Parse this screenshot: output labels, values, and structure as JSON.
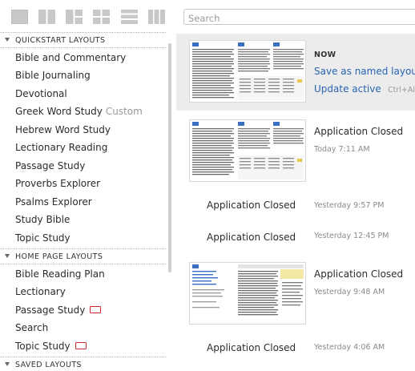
{
  "toolbar": {
    "layout_buttons": [
      "single-pane-layout",
      "two-column-layout",
      "three-pane-layout",
      "four-pane-layout",
      "rows-layout",
      "three-column-layout"
    ],
    "search_placeholder": "Search"
  },
  "sections": [
    {
      "title": "QUICKSTART LAYOUTS",
      "items": [
        {
          "label": "Bible and Commentary"
        },
        {
          "label": "Bible Journaling"
        },
        {
          "label": "Devotional"
        },
        {
          "label": "Greek Word Study",
          "tag": "Custom"
        },
        {
          "label": "Hebrew Word Study"
        },
        {
          "label": "Lectionary Reading"
        },
        {
          "label": "Passage Study"
        },
        {
          "label": "Proverbs Explorer"
        },
        {
          "label": "Psalms Explorer"
        },
        {
          "label": "Study Bible"
        },
        {
          "label": "Topic Study"
        }
      ]
    },
    {
      "title": "HOME PAGE LAYOUTS",
      "items": [
        {
          "label": "Bible Reading Plan"
        },
        {
          "label": "Lectionary"
        },
        {
          "label": "Passage Study",
          "badge": "red"
        },
        {
          "label": "Search"
        },
        {
          "label": "Topic Study",
          "badge": "red"
        }
      ]
    },
    {
      "title": "SAVED LAYOUTS",
      "items": []
    }
  ],
  "history": {
    "current": {
      "label": "NOW",
      "save_link": "Save as named layout",
      "update_link": "Update active",
      "update_shortcut": "Ctrl+Alt"
    },
    "entries": [
      {
        "title": "Application Closed",
        "time": "Today 7:11 AM"
      },
      {
        "title": "Application Closed",
        "time": "Yesterday 9:57 PM"
      },
      {
        "title": "Application Closed",
        "time": "Yesterday 12:45 PM"
      },
      {
        "title": "Application Closed",
        "time": "Yesterday 9:48 AM"
      },
      {
        "title": "Application Closed",
        "time": "Yesterday 4:06 AM"
      }
    ]
  },
  "colors": {
    "link": "#2864b4",
    "badge": "#d0282e",
    "active_bg": "#ececec"
  }
}
